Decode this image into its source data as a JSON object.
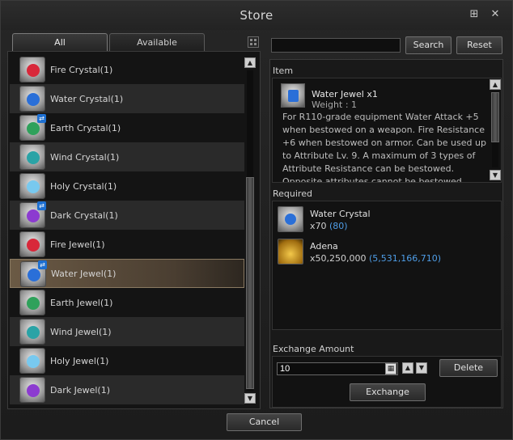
{
  "window": {
    "title": "Store"
  },
  "title_icons": [
    "grid-settings-icon",
    "close-icon"
  ],
  "tabs": [
    {
      "label": "All",
      "active": true
    },
    {
      "label": "Available",
      "active": false
    }
  ],
  "items": [
    {
      "label": "Fire Crystal(1)",
      "gem_color": "#d8283a",
      "badge": false
    },
    {
      "label": "Water Crystal(1)",
      "gem_color": "#2a6fd8",
      "badge": false
    },
    {
      "label": "Earth Crystal(1)",
      "gem_color": "#2fa15b",
      "badge": true
    },
    {
      "label": "Wind Crystal(1)",
      "gem_color": "#2aa3a6",
      "badge": false
    },
    {
      "label": "Holy Crystal(1)",
      "gem_color": "#78c9ef",
      "badge": false
    },
    {
      "label": "Dark Crystal(1)",
      "gem_color": "#8c3bd0",
      "badge": true
    },
    {
      "label": "Fire Jewel(1)",
      "gem_color": "#d8283a",
      "badge": false
    },
    {
      "label": "Water Jewel(1)",
      "gem_color": "#2a6fd8",
      "badge": true,
      "selected": true
    },
    {
      "label": "Earth Jewel(1)",
      "gem_color": "#2fa15b",
      "badge": false
    },
    {
      "label": "Wind Jewel(1)",
      "gem_color": "#2aa3a6",
      "badge": false
    },
    {
      "label": "Holy Jewel(1)",
      "gem_color": "#78c9ef",
      "badge": false
    },
    {
      "label": "Dark Jewel(1)",
      "gem_color": "#8c3bd0",
      "badge": false
    }
  ],
  "search": {
    "value": "",
    "search_label": "Search",
    "reset_label": "Reset"
  },
  "item_section": {
    "label": "Item",
    "name": "Water Jewel x1",
    "weight": "Weight : 1",
    "description": "For R110-grade equipment\nWater Attack +5 when bestowed on a weapon. Fire Resistance +6 when bestowed on armor. Can be used up to Attribute Lv. 9. A maximum of 3 types of Attribute Resistance can be bestowed. Opposite attributes cannot be bestowed together."
  },
  "required": {
    "label": "Required",
    "materials": [
      {
        "name": "Water Crystal",
        "qty": "x70",
        "have": "(80)",
        "icon": "water-crystal-icon"
      },
      {
        "name": "Adena",
        "qty": "x50,250,000",
        "have": "(5,531,166,710)",
        "icon": "adena-coin-icon"
      }
    ]
  },
  "exchange": {
    "label": "Exchange Amount",
    "value": "10",
    "delete_label": "Delete",
    "exchange_label": "Exchange"
  },
  "cancel_label": "Cancel",
  "colors": {
    "selected_row": "#6b5a45",
    "owned_count": "#4f9ee8",
    "badge": "#1d6fd1"
  }
}
